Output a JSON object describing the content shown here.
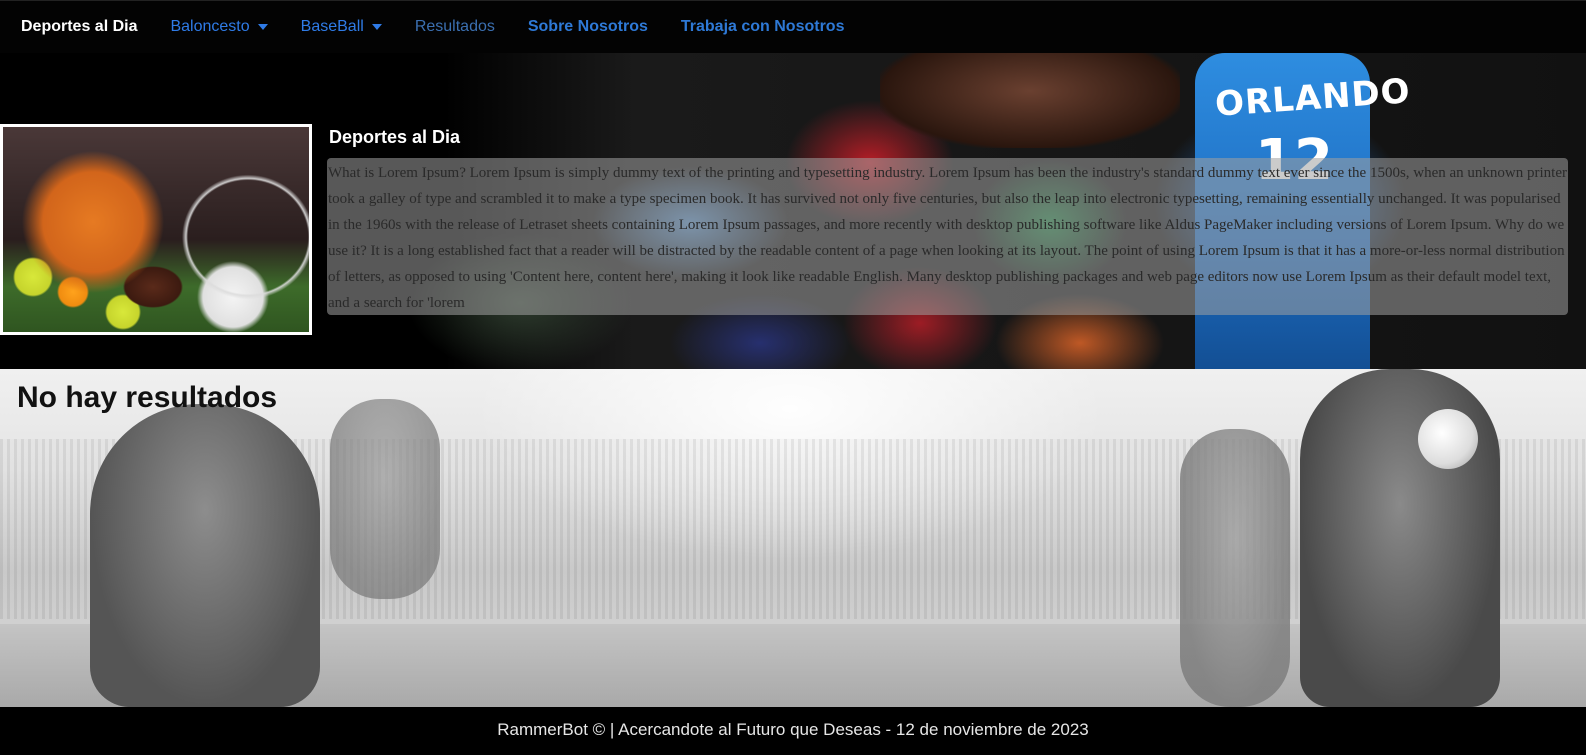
{
  "nav": {
    "brand": "Deportes al Dia",
    "items": [
      {
        "label": "Baloncesto",
        "dropdown": true
      },
      {
        "label": "BaseBall",
        "dropdown": true
      },
      {
        "label": "Resultados",
        "dropdown": false
      },
      {
        "label": "Sobre Nosotros",
        "dropdown": false
      },
      {
        "label": "Trabaja con Nosotros",
        "dropdown": false
      }
    ]
  },
  "hero": {
    "title": "Deportes al Dia",
    "jersey_text": "ORLANDO",
    "jersey_number": "12",
    "text": "What is Lorem Ipsum? Lorem Ipsum is simply dummy text of the printing and typesetting industry. Lorem Ipsum has been the industry's standard dummy text ever since the 1500s, when an unknown printer took a galley of type and scrambled it to make a type specimen book. It has survived not only five centuries, but also the leap into electronic typesetting, remaining essentially unchanged. It was popularised in the 1960s with the release of Letraset sheets containing Lorem Ipsum passages, and more recently with desktop publishing software like Aldus PageMaker including versions of Lorem Ipsum. Why do we use it? It is a long established fact that a reader will be distracted by the readable content of a page when looking at its layout. The point of using Lorem Ipsum is that it has a more-or-less normal distribution of letters, as opposed to using 'Content here, content here', making it look like readable English. Many desktop publishing packages and web page editors now use Lorem Ipsum as their default model text, and a search for 'lorem"
  },
  "main": {
    "message": "No hay resultados"
  },
  "footer": {
    "text": "RammerBot © | Acercandote al Futuro que Deseas - 12 de noviembre de 2023"
  },
  "colors": {
    "nav_bg": "#030303",
    "link": "#2f7be6",
    "footer_bg": "#000000"
  }
}
